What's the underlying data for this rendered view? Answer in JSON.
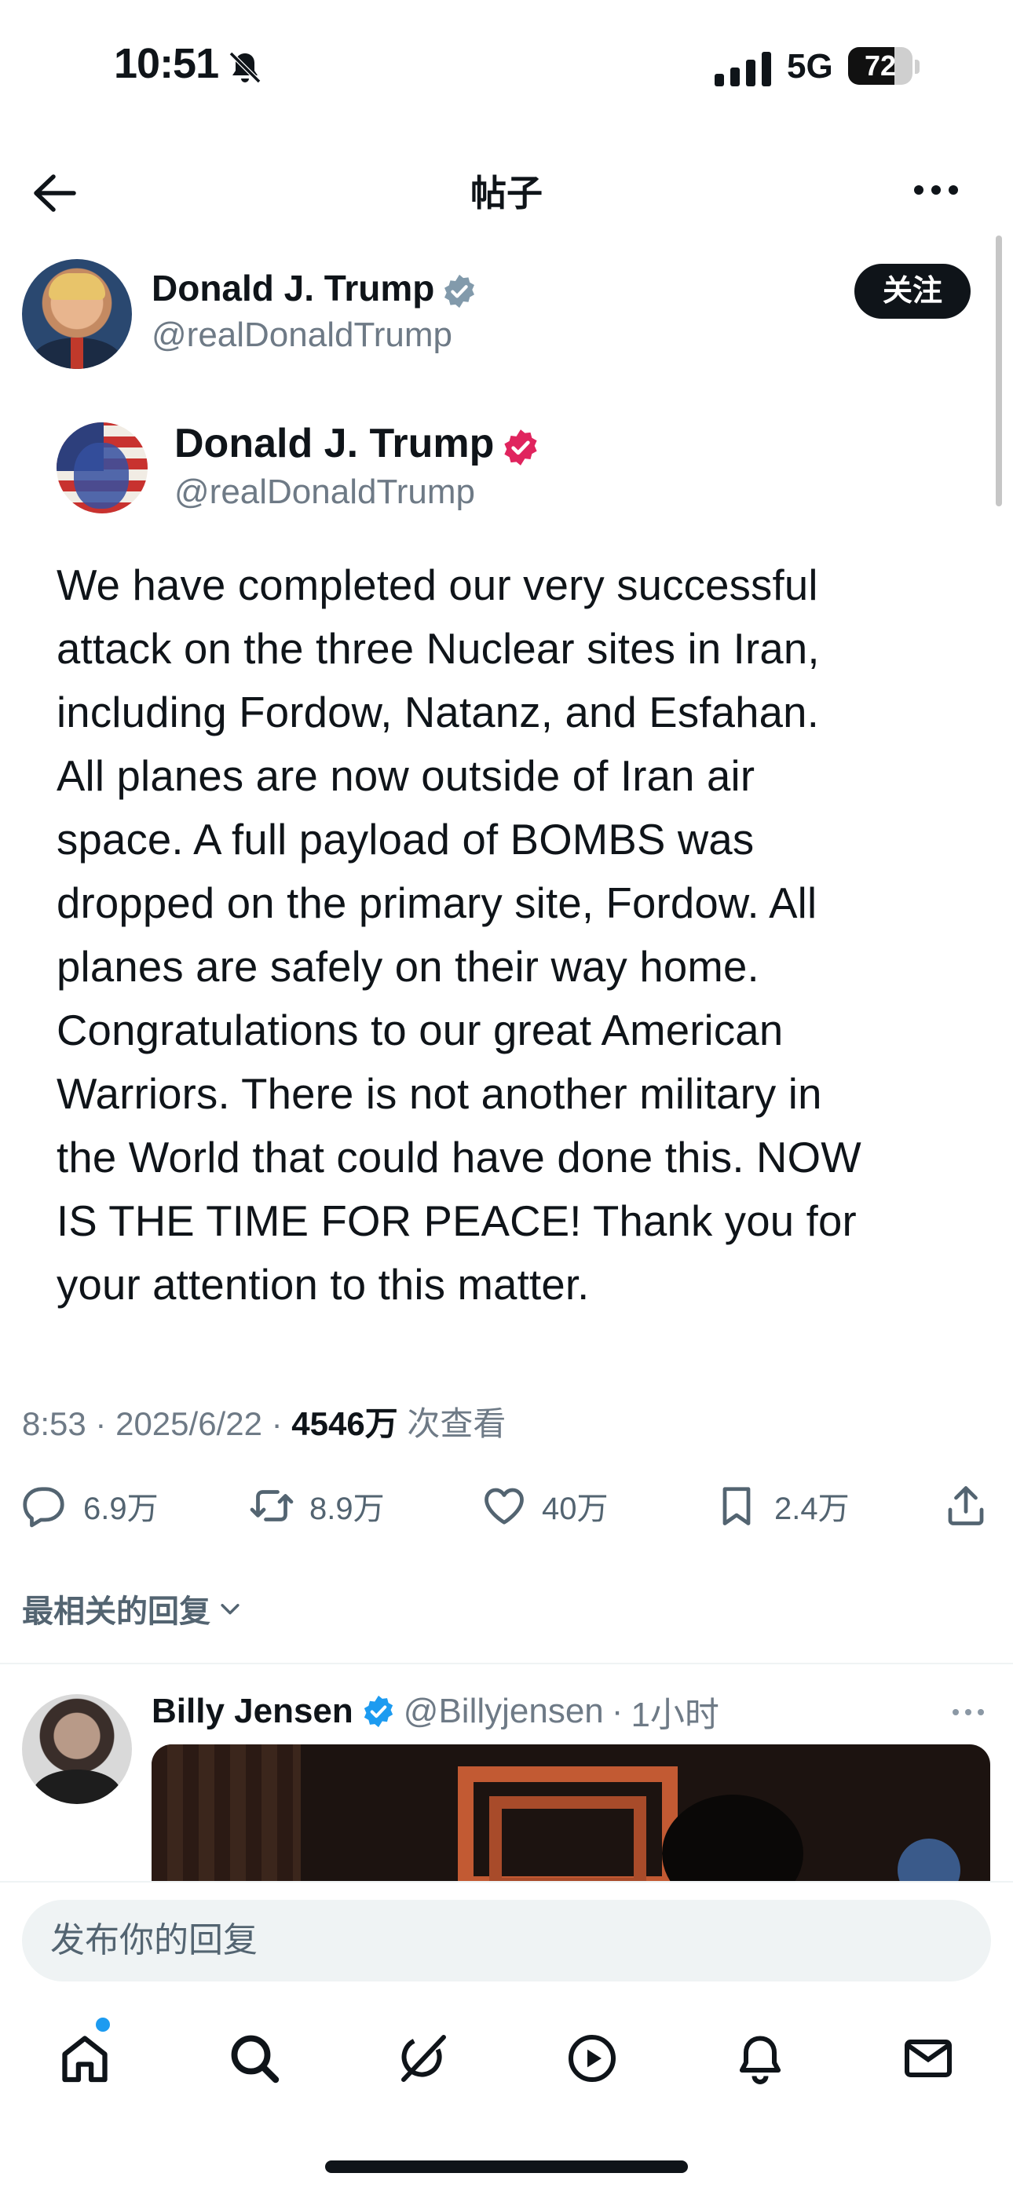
{
  "status_bar": {
    "time": "10:51",
    "network": "5G",
    "battery_level": "72",
    "battery_fraction": 0.72
  },
  "header": {
    "title": "帖子"
  },
  "author": {
    "name": "Donald J. Trump",
    "handle": "@realDonaldTrump",
    "follow_label": "关注"
  },
  "embedded_post": {
    "name": "Donald J. Trump",
    "handle": "@realDonaldTrump",
    "text": "We have completed our very successful\nattack on the three Nuclear sites in Iran,\nincluding Fordow, Natanz, and Esfahan.\nAll planes are now outside of Iran air\nspace. A full payload of BOMBS was\ndropped on the primary site, Fordow. All\nplanes are safely on their way home.\nCongratulations to our great American\nWarriors. There is not another military in\nthe World that could have done this. NOW\nIS THE TIME FOR PEACE! Thank you for\nyour attention to this matter."
  },
  "meta": {
    "time": "8:53",
    "separator": "·",
    "date": "2025/6/22",
    "views_count": "4546万",
    "views_label": "次查看"
  },
  "actions": {
    "replies": "6.9万",
    "reposts": "8.9万",
    "likes": "40万",
    "bookmarks": "2.4万"
  },
  "replies_filter": {
    "label": "最相关的回复"
  },
  "reply": {
    "name": "Billy Jensen",
    "handle": "@Billyjensen",
    "separator": "·",
    "time": "1小时"
  },
  "composer": {
    "placeholder": "发布你的回复"
  },
  "colors": {
    "verified_gray": "#829aab",
    "verified_pink": "#e0245e",
    "verified_blue": "#1d9bf0",
    "text_primary": "#0f1419",
    "text_secondary": "#6e7a86"
  },
  "nav": {
    "items": [
      "home-icon",
      "search-icon",
      "grok-icon",
      "video-icon",
      "notifications-icon",
      "messages-icon"
    ]
  }
}
